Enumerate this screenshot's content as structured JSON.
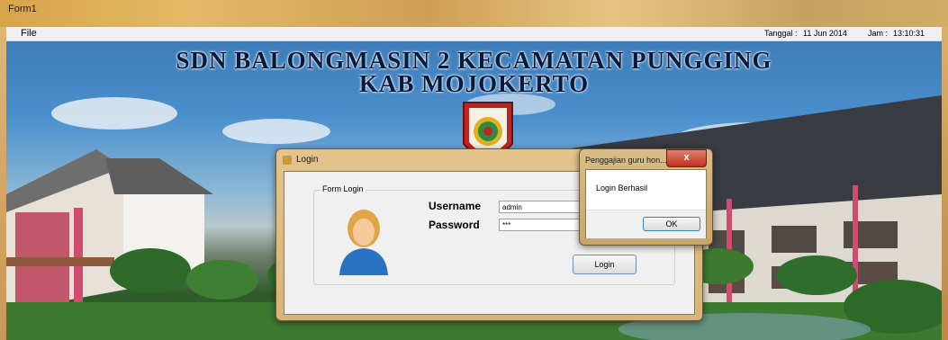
{
  "window": {
    "title": "Form1"
  },
  "menu": {
    "file": "File",
    "date_label": "Tanggal :",
    "date_value": "11 Jun 2014",
    "time_label": "Jam :",
    "time_value": "13:10:31"
  },
  "banner": {
    "line1": "SDN BALONGMASIN 2 KECAMATAN PUNGGING",
    "line2": "KAB MOJOKERTO"
  },
  "login_dialog": {
    "title": "Login",
    "group_label": "Form Login",
    "username_label": "Username",
    "username_value": "admin",
    "password_label": "Password",
    "password_value": "***",
    "login_button": "Login"
  },
  "message_box": {
    "title": "Penggajian guru hon...",
    "close_symbol": "x",
    "message": "Login Berhasil",
    "ok_button": "OK"
  },
  "icons": {
    "app": "form-icon",
    "emblem": "regional-emblem",
    "user": "user-avatar-icon"
  }
}
